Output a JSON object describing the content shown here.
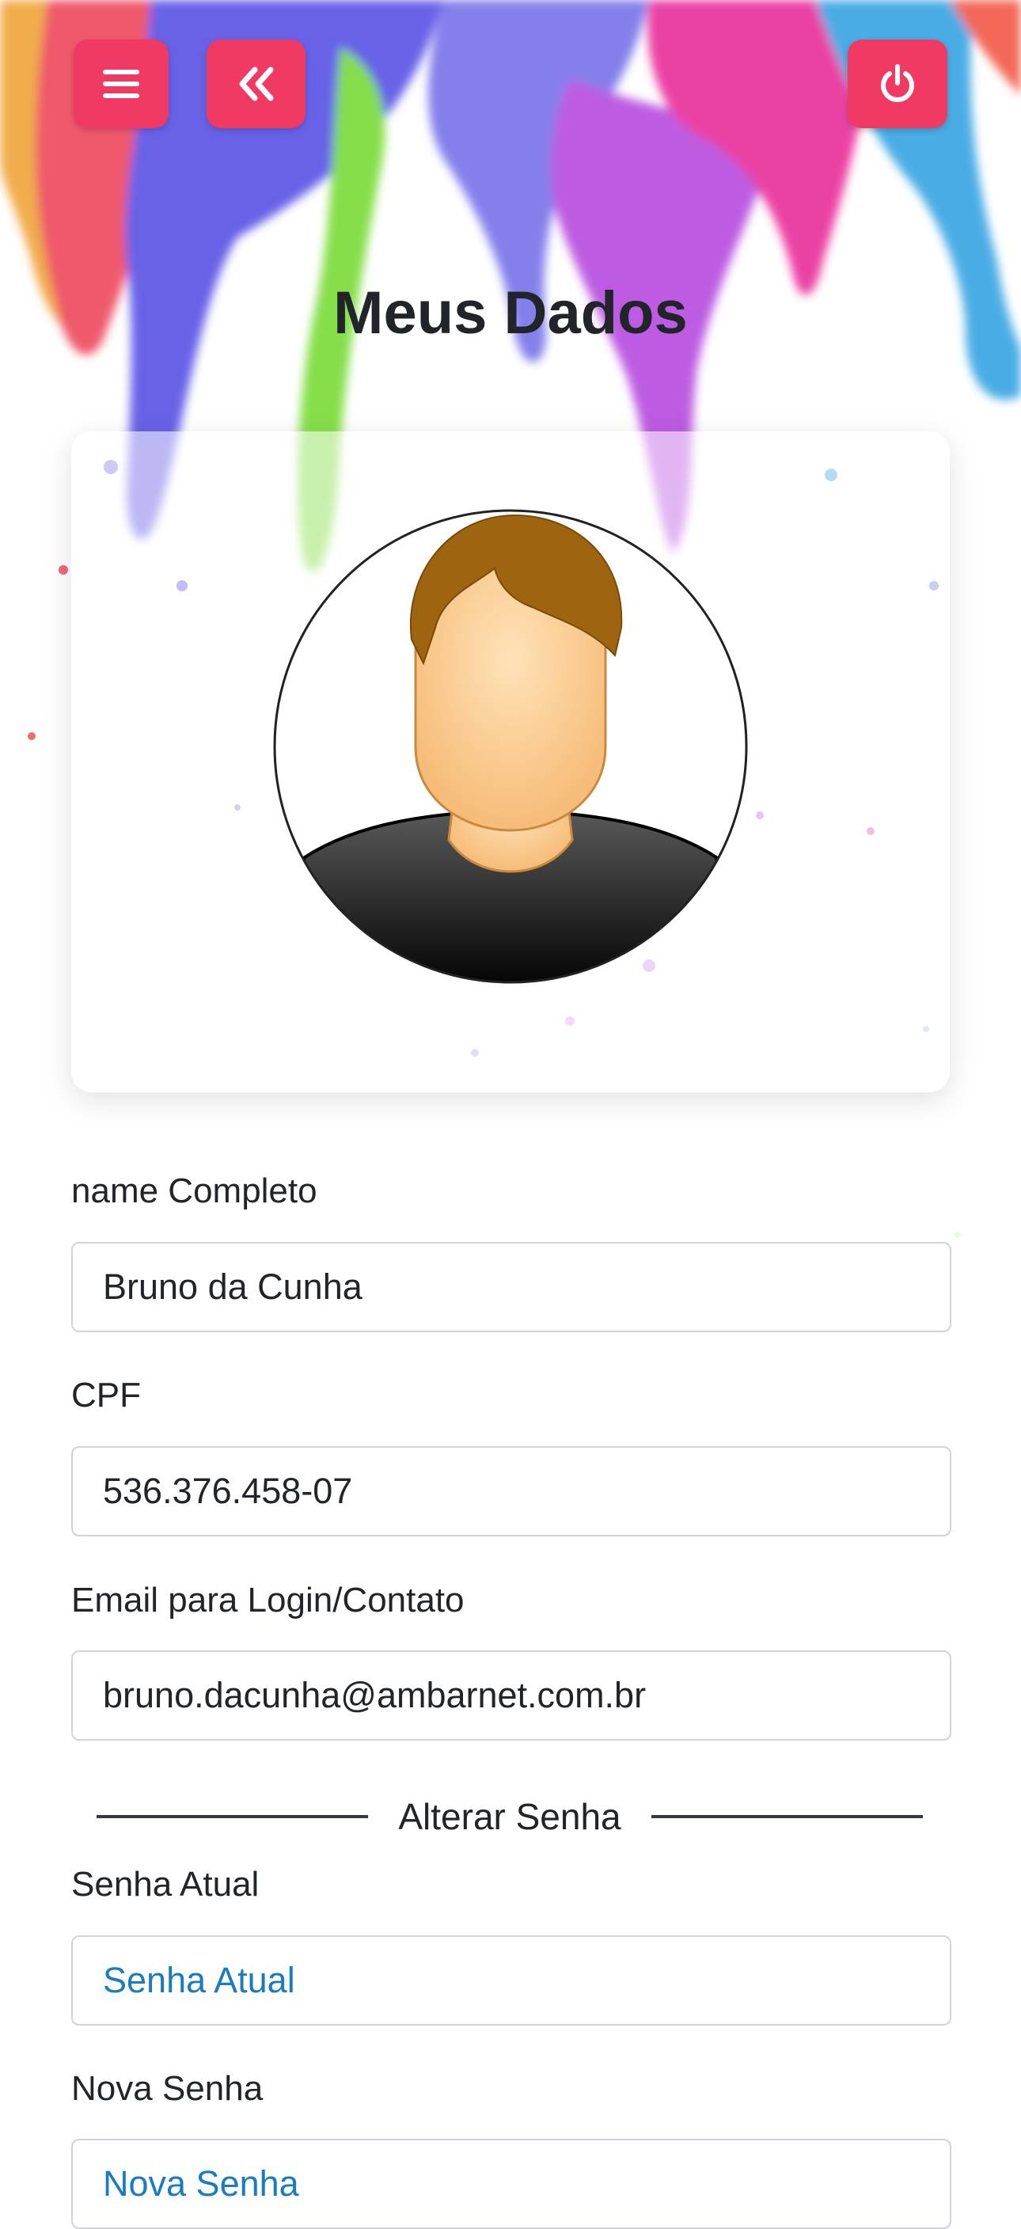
{
  "header": {
    "menu_icon": "hamburger-icon",
    "back_icon": "double-chevron-left-icon",
    "logout_icon": "power-icon",
    "accent_color": "#f03a64"
  },
  "page": {
    "title": "Meus Dados"
  },
  "profile": {
    "avatar_icon": "user-avatar"
  },
  "form": {
    "name": {
      "label": "name Completo",
      "value": "Bruno da Cunha"
    },
    "cpf": {
      "label": "CPF",
      "value": "536.376.458-07"
    },
    "email": {
      "label": "Email para Login/Contato",
      "value": "bruno.dacunha@ambarnet.com.br"
    },
    "password_section": "Alterar Senha",
    "current_password": {
      "label": "Senha Atual",
      "placeholder": "Senha Atual"
    },
    "new_password": {
      "label": "Nova Senha",
      "placeholder": "Nova Senha"
    }
  }
}
